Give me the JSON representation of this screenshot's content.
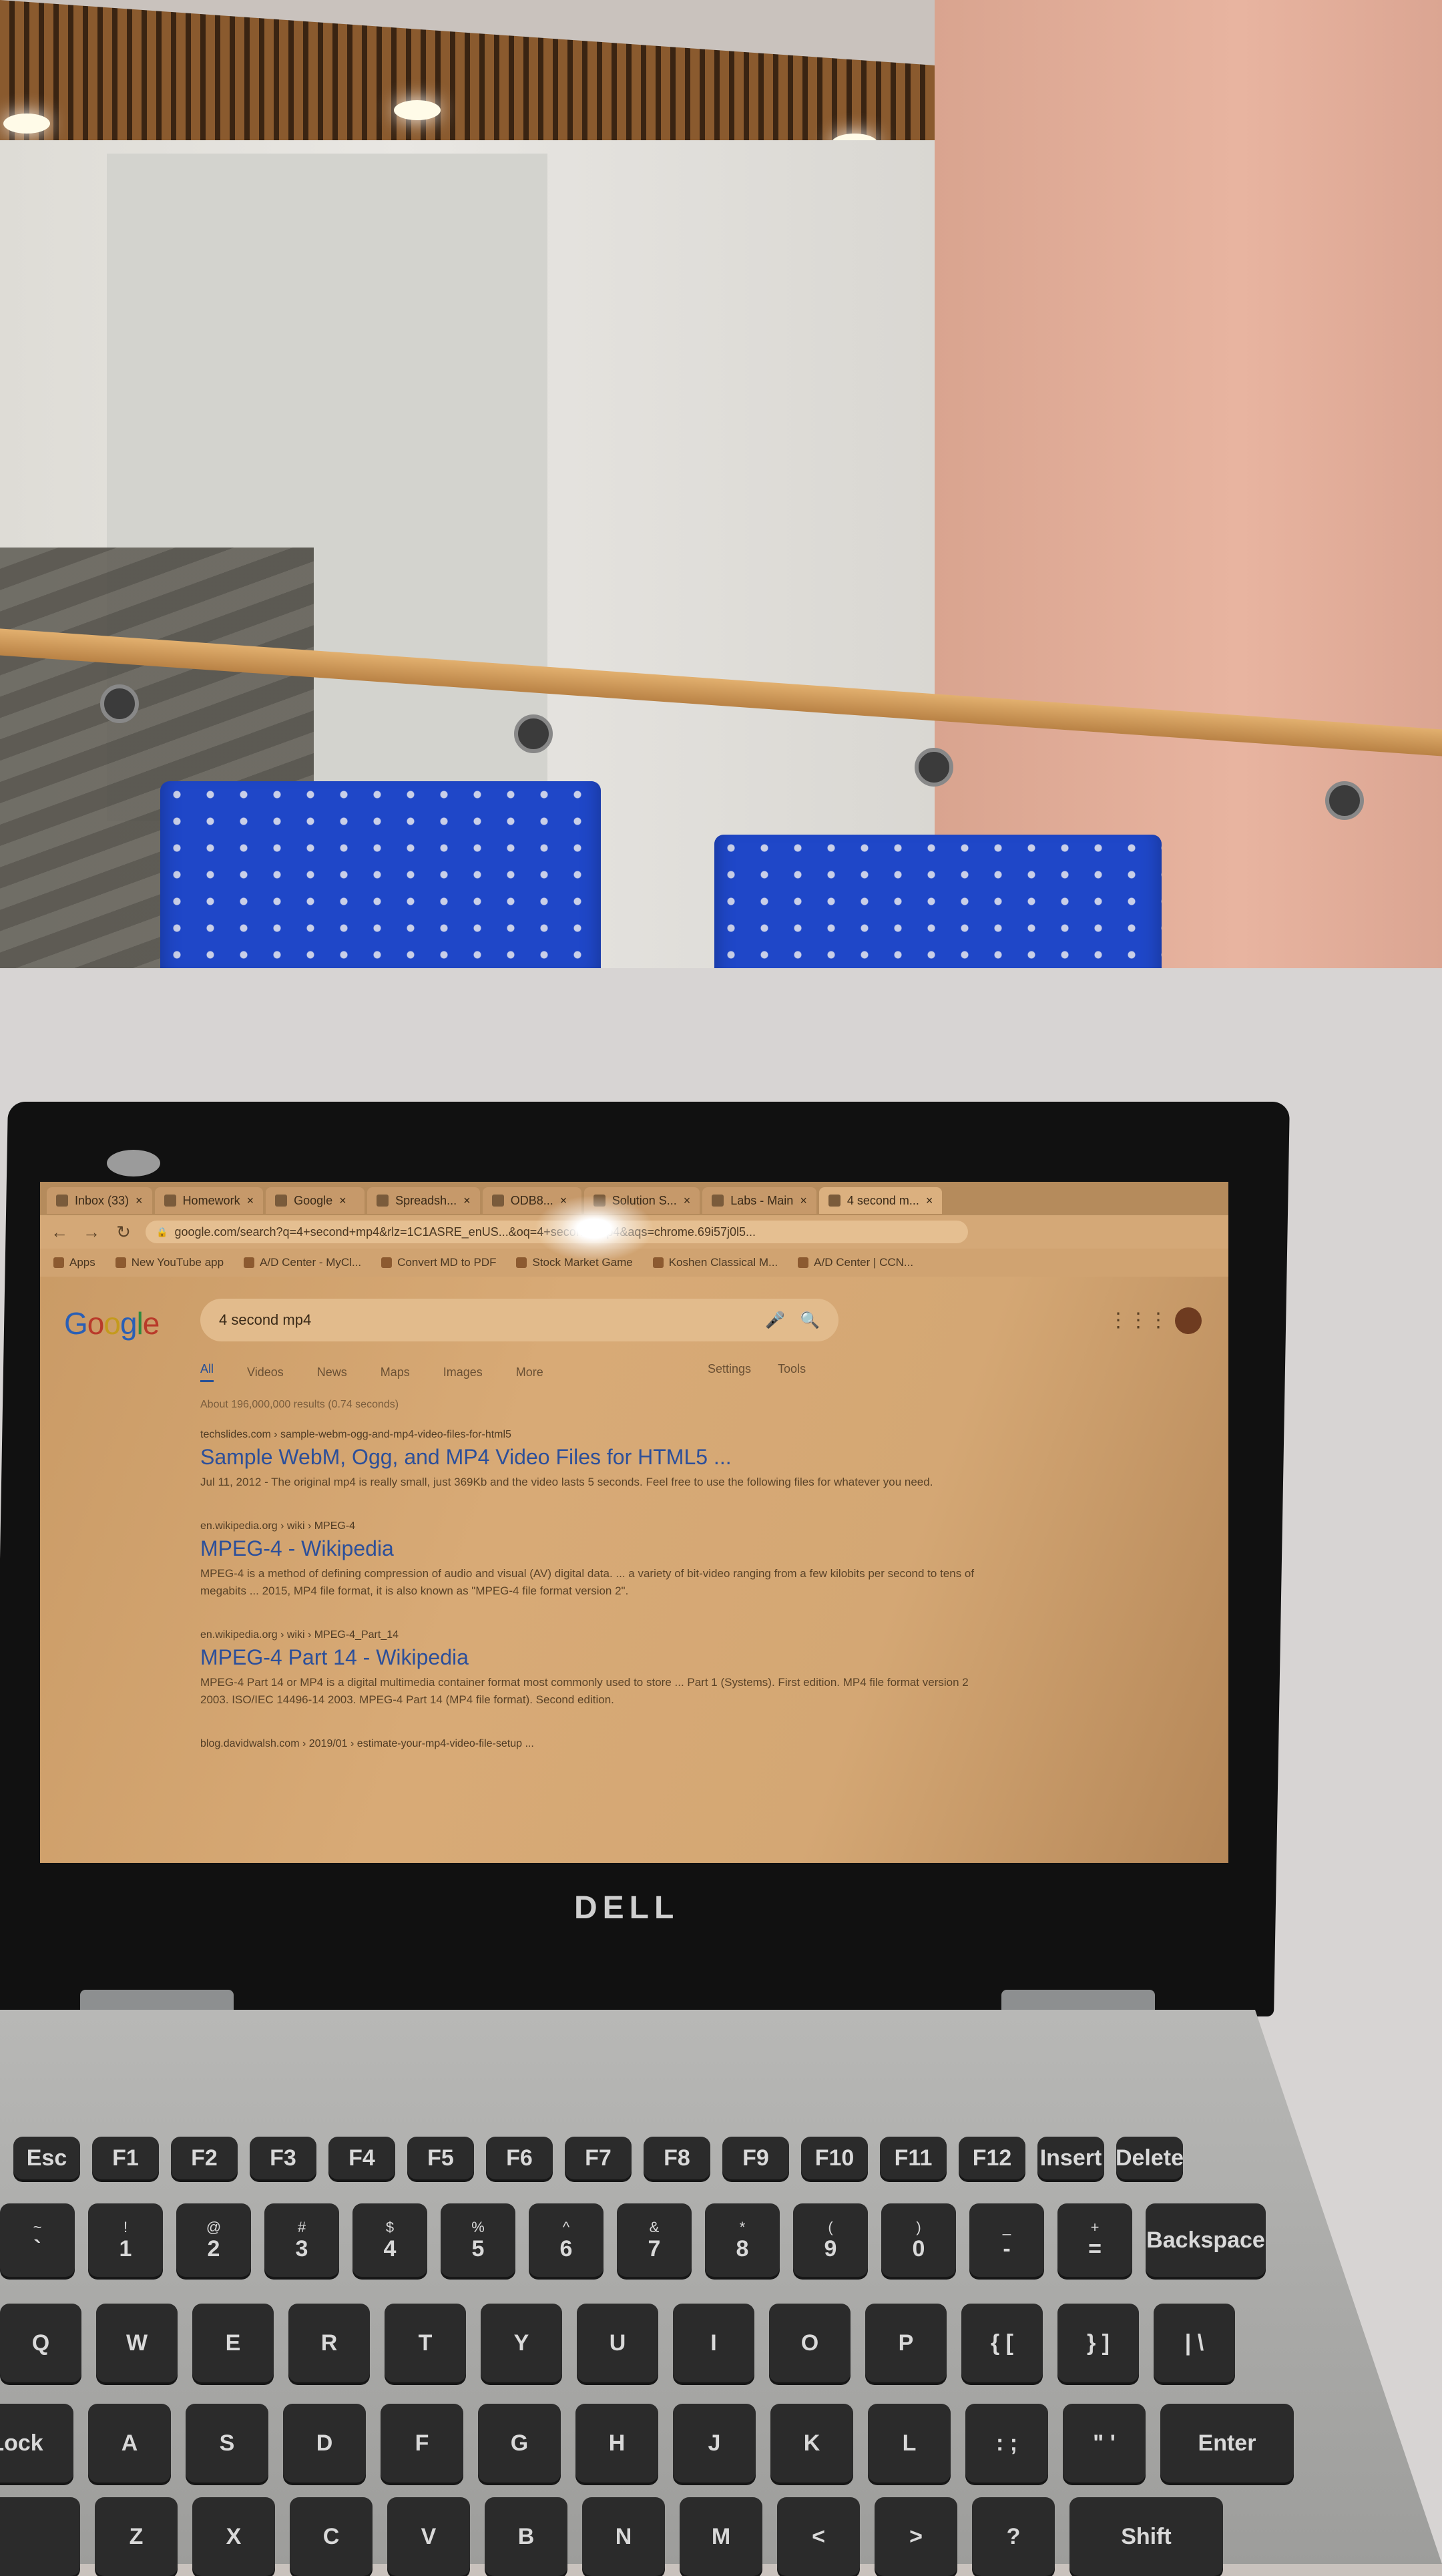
{
  "browser": {
    "tabs": [
      {
        "label": "Inbox (33)"
      },
      {
        "label": "Homework"
      },
      {
        "label": "Google"
      },
      {
        "label": "Spreadsh..."
      },
      {
        "label": "ODB8..."
      },
      {
        "label": "Solution S..."
      },
      {
        "label": "Labs - Main"
      },
      {
        "label": "4 second m..."
      }
    ],
    "nav": {
      "back": "←",
      "forward": "→",
      "reload": "↻",
      "lock": "🔒"
    },
    "address": "google.com/search?q=4+second+mp4&rlz=1C1ASRE_enUS...&oq=4+second+mp4&aqs=chrome.69i57j0l5...",
    "bookmarks": [
      {
        "label": "Apps"
      },
      {
        "label": "New YouTube app"
      },
      {
        "label": "A/D Center - MyCl..."
      },
      {
        "label": "Convert MD to PDF"
      },
      {
        "label": "Stock Market Game"
      },
      {
        "label": "Koshen Classical M..."
      },
      {
        "label": "A/D Center | CCN..."
      }
    ]
  },
  "search": {
    "logo": [
      "G",
      "o",
      "o",
      "g",
      "l",
      "e"
    ],
    "query": "4 second mp4",
    "mic_icon": "🎤",
    "search_icon": "🔍",
    "apps_icon": "⋮⋮⋮",
    "tabs": [
      {
        "label": "All",
        "active": true
      },
      {
        "label": "Videos",
        "active": false
      },
      {
        "label": "News",
        "active": false
      },
      {
        "label": "Maps",
        "active": false
      },
      {
        "label": "Images",
        "active": false
      },
      {
        "label": "More",
        "active": false
      }
    ],
    "settings": "Settings",
    "tools": "Tools",
    "stats": "About 196,000,000 results (0.74 seconds)",
    "results": [
      {
        "url": "techslides.com › sample-webm-ogg-and-mp4-video-files-for-html5",
        "title": "Sample WebM, Ogg, and MP4 Video Files for HTML5 ...",
        "snippet": "Jul 11, 2012 - The original mp4 is really small, just 369Kb and the video lasts 5 seconds. Feel free to use the following files for whatever you need."
      },
      {
        "url": "en.wikipedia.org › wiki › MPEG-4",
        "title": "MPEG-4 - Wikipedia",
        "snippet": "MPEG-4 is a method of defining compression of audio and visual (AV) digital data. ... a variety of bit-video ranging from a few kilobits per second to tens of megabits ... 2015, MP4 file format, it is also known as \"MPEG-4 file format version 2\"."
      },
      {
        "url": "en.wikipedia.org › wiki › MPEG-4_Part_14",
        "title": "MPEG-4 Part 14 - Wikipedia",
        "snippet": "MPEG-4 Part 14 or MP4 is a digital multimedia container format most commonly used to store ... Part 1 (Systems). First edition. MP4 file format version 2 2003. ISO/IEC 14496-14 2003. MPEG-4 Part 14 (MP4 file format). Second edition."
      },
      {
        "url": "blog.davidwalsh.com › 2019/01 › estimate-your-mp4-video-file-setup ...",
        "title": "",
        "snippet": ""
      }
    ]
  },
  "laptop": {
    "brand": "DELL",
    "keyboard": {
      "fn_row": [
        "Esc",
        "F1",
        "F2",
        "F3",
        "F4",
        "F5",
        "F6",
        "F7",
        "F8",
        "F9",
        "F10",
        "F11",
        "F12",
        "Insert",
        "Delete"
      ],
      "num_row": [
        [
          "~",
          "`"
        ],
        [
          "!",
          "1"
        ],
        [
          "@",
          "2"
        ],
        [
          "#",
          "3"
        ],
        [
          "$",
          "4"
        ],
        [
          "%",
          "5"
        ],
        [
          "^",
          "6"
        ],
        [
          "&",
          "7"
        ],
        [
          "*",
          "8"
        ],
        [
          "(",
          "9"
        ],
        [
          ")",
          "0"
        ],
        [
          "_",
          "-"
        ],
        [
          "+",
          "="
        ],
        [
          "",
          "Backspace"
        ]
      ],
      "qwerty_row": [
        "Q",
        "W",
        "E",
        "R",
        "T",
        "Y",
        "U",
        "I",
        "O",
        "P",
        "{ [",
        "} ]",
        "| \\"
      ],
      "home_row": [
        "Lock",
        "A",
        "S",
        "D",
        "F",
        "G",
        "H",
        "J",
        "K",
        "L",
        ": ;",
        "\" '",
        "Enter"
      ],
      "bottom_row": [
        "",
        "Z",
        "X",
        "C",
        "V",
        "B",
        "N",
        "M",
        "<",
        ">",
        "?",
        "Shift"
      ]
    }
  },
  "colors": {
    "chair": "#1f47c8",
    "screen_tint": "#d4a774",
    "link": "#2c4f9a"
  }
}
